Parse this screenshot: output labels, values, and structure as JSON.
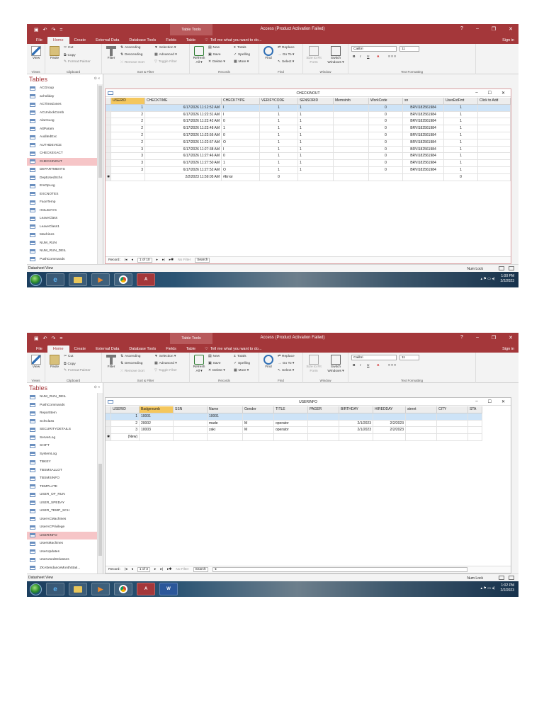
{
  "common": {
    "qat_undo": "↶",
    "qat_redo": "↷",
    "qat_more": "=",
    "context_tab": "Table Tools",
    "app_title": "Access (Product Activation Failed)",
    "help": "?",
    "minimize": "–",
    "restore": "❐",
    "close": "✕",
    "tabs": [
      "File",
      "Home",
      "Create",
      "External Data",
      "Database Tools",
      "Fields",
      "Table"
    ],
    "tell_me": "Tell me what you want to do...",
    "sign_in": "Sign in",
    "ribbon": {
      "view": "View",
      "paste": "Paste",
      "cut": "Cut",
      "copy": "Copy",
      "format_painter": "Format Painter",
      "filter": "Filter",
      "ascending": "Ascending",
      "descending": "Descending",
      "remove_sort": "Remove Sort",
      "selection": "Selection ▾",
      "advanced": "Advanced ▾",
      "toggle_filter": "Toggle Filter",
      "refresh": "Refresh All ▾",
      "new": "New",
      "save": "Save",
      "delete": "Delete ▾",
      "totals": "Totals",
      "spelling": "Spelling",
      "more": "More ▾",
      "find": "Find",
      "replace": "Replace",
      "goto": "Go To ▾",
      "select": "Select ▾",
      "size_to_fit": "Size to Fit Form",
      "switch_windows": "Switch Windows ▾",
      "font_name": "Calibri",
      "font_size": "11",
      "bold": "B",
      "italic": "I",
      "underline": "U",
      "groups": [
        "Views",
        "Clipboard",
        "Sort & Filter",
        "Records",
        "Find",
        "Window",
        "Text Formatting"
      ]
    },
    "nav_title": "Tables",
    "nav_controls": "⊙ «",
    "status_left": "Datasheet View",
    "num_lock": "Num Lock"
  },
  "shot1": {
    "nav_items": [
      "ACGroup",
      "acholiday",
      "ACTimeZones",
      "ACUnlockComb",
      "AlarmLog",
      "AttParam",
      "AuditedExc",
      "AUTHDEVICE",
      "CHECKEXACT",
      "CHECKINOUT",
      "DEPARTMENTS",
      "DeptUsedSchs",
      "EmOpLog",
      "EXCNOTES",
      "FaceTemp",
      "HOLIDAYS",
      "LeaveClass",
      "LeaveClass1",
      "Machines",
      "NUM_RUN",
      "NUM_RUN_DEIL",
      "PushCommands"
    ],
    "doc_title": "CHECKINOUT",
    "columns": [
      "USERID",
      "CHECKTIME",
      "CHECKTYPE",
      "VERIFYCODE",
      "SENSORID",
      "Memoinfo",
      "WorkCode",
      "sn",
      "UserExtFmt",
      "Click to Add"
    ],
    "rows": [
      [
        "1",
        "6/17/2026 11:12:52 AM",
        "I",
        "1",
        "1",
        "",
        "0",
        "BRVI182561984",
        "1"
      ],
      [
        "2",
        "6/17/2026 11:22:31 AM",
        "I",
        "1",
        "1",
        "",
        "0",
        "BRVI182561984",
        "1"
      ],
      [
        "2",
        "6/17/2026 11:22:42 AM",
        "0",
        "1",
        "1",
        "",
        "0",
        "BRVI182561984",
        "1"
      ],
      [
        "2",
        "6/17/2026 11:22:48 AM",
        "1",
        "1",
        "1",
        "",
        "0",
        "BRVI182561984",
        "1"
      ],
      [
        "2",
        "6/17/2026 11:22:56 AM",
        "0",
        "1",
        "1",
        "",
        "0",
        "BRVI182561984",
        "1"
      ],
      [
        "2",
        "6/17/2026 11:22:57 AM",
        "O",
        "1",
        "1",
        "",
        "0",
        "BRVI182561984",
        "1"
      ],
      [
        "3",
        "6/17/2026 11:27:38 AM",
        "I",
        "1",
        "1",
        "",
        "0",
        "BRVI182561984",
        "1"
      ],
      [
        "3",
        "6/17/2026 11:27:46 AM",
        "0",
        "1",
        "1",
        "",
        "0",
        "BRVI182561984",
        "1"
      ],
      [
        "3",
        "6/17/2026 11:27:50 AM",
        "1",
        "1",
        "1",
        "",
        "0",
        "BRVI182561984",
        "1"
      ],
      [
        "3",
        "6/17/2026 11:27:52 AM",
        "O",
        "1",
        "1",
        "",
        "0",
        "BRVI182561984",
        "1"
      ]
    ],
    "new_row": [
      "",
      "2/2/2023 11:59:05 AM",
      "#Error",
      "0",
      "",
      "",
      "",
      "",
      "0"
    ],
    "record_label": "Record:",
    "record_pos": "1 of 10",
    "no_filter": "No Filter",
    "search": "Search",
    "clock_time": "1:00 PM",
    "clock_date": "2/2/2023"
  },
  "shot2": {
    "nav_items": [
      "NUM_RUN_DEIL",
      "PushCommands",
      "ReportItem",
      "SchClass",
      "SECURITYDETAILS",
      "ServerLog",
      "SHIFT",
      "SystemLog",
      "TBKEY",
      "TBSMSALLOT",
      "TBSMSINFO",
      "TEMPLATE",
      "USER_OF_RUN",
      "USER_SPEDAY",
      "USER_TEMP_SCH",
      "UserACMachines",
      "UserACPrivilege",
      "USERINFO",
      "UsersMachines",
      "UserUpdates",
      "UserUsedSClasses",
      "ZKAttendanceMonthStati..."
    ],
    "doc_title": "USERINFO",
    "columns": [
      "USERID",
      "Badgenumb",
      "SSN",
      "Name",
      "Gender",
      "TITLE",
      "PAGER",
      "BIRTHDAY",
      "HIREDDAY",
      "street",
      "CITY",
      "STA"
    ],
    "rows": [
      [
        "1",
        "10001",
        "",
        "10001",
        "",
        "",
        "",
        "",
        "",
        "",
        "",
        ""
      ],
      [
        "2",
        "20002",
        "",
        "made",
        "M",
        "operator",
        "",
        "2/1/2023",
        "2/2/2023",
        "",
        "",
        ""
      ],
      [
        "3",
        "10003",
        "",
        "zaki",
        "M",
        "operator",
        "",
        "2/1/2023",
        "2/2/2023",
        "",
        "",
        ""
      ]
    ],
    "new_row": [
      "(New)",
      "",
      "",
      "",
      "",
      "",
      "",
      "",
      "",
      "",
      "",
      ""
    ],
    "record_label": "Record:",
    "record_pos": "1 of 3",
    "no_filter": "No Filter",
    "search": "Search",
    "clock_time": "1:02 PM",
    "clock_date": "2/2/2023"
  },
  "taskbar_apps": [
    "ie",
    "explorer",
    "media",
    "chrome",
    "access",
    "word"
  ],
  "taskbar_labels": {
    "access": "A",
    "word": "W"
  },
  "colors": {
    "access_red": "#a4373a",
    "selected_nav": "#f6c5c7",
    "sort_col": "#f4c75e",
    "selected_row": "#cde3f7"
  }
}
